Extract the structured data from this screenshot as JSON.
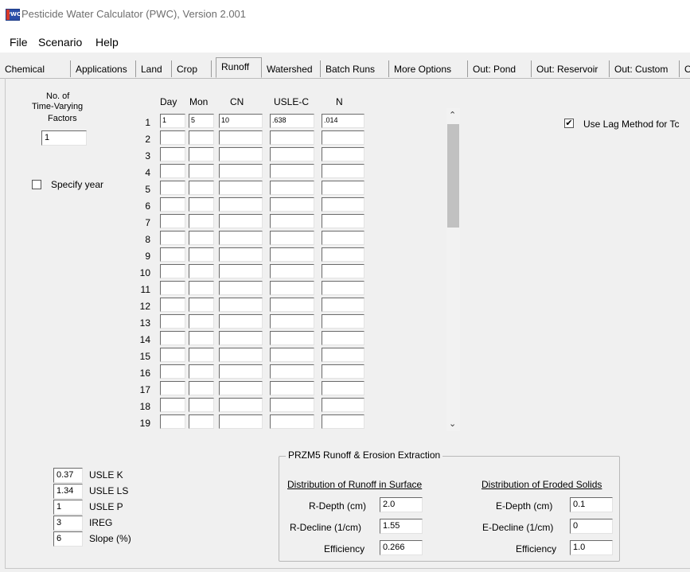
{
  "window": {
    "title": "Pesticide Water Calculator (PWC), Version 2.001",
    "icon_text": "PWC"
  },
  "menu": [
    {
      "label": "File"
    },
    {
      "label": "Scenario"
    },
    {
      "label": "Help"
    }
  ],
  "tabs": [
    {
      "label": "Chemical",
      "active": false
    },
    {
      "label": "Applications",
      "active": false
    },
    {
      "label": "Land",
      "active": false
    },
    {
      "label": "Crop",
      "active": false
    },
    {
      "label": "Runoff",
      "active": true
    },
    {
      "label": "Watershed",
      "active": false
    },
    {
      "label": "Batch Runs",
      "active": false
    },
    {
      "label": "More Options",
      "active": false
    },
    {
      "label": "Out: Pond",
      "active": false
    },
    {
      "label": "Out: Reservoir",
      "active": false
    },
    {
      "label": "Out: Custom",
      "active": false
    },
    {
      "label": "Ou",
      "active": false
    }
  ],
  "runoff": {
    "factors_label_1": "No. of",
    "factors_label_2": "Time-Varying",
    "factors_label_3": "Factors",
    "factors_value": "1",
    "specify_year_label": "Specify year",
    "specify_year_checked": false,
    "lag_method_label": "Use Lag Method for Tc",
    "lag_method_checked": true,
    "lag_method_mark": "✔",
    "columns": [
      "Day",
      "Mon",
      "CN",
      "USLE-C",
      "N"
    ],
    "rows": [
      {
        "num": "1",
        "day": "1",
        "mon": "5",
        "cn": "10",
        "uslec": ".638",
        "n": ".014"
      },
      {
        "num": "2",
        "day": "",
        "mon": "",
        "cn": "",
        "uslec": "",
        "n": ""
      },
      {
        "num": "3",
        "day": "",
        "mon": "",
        "cn": "",
        "uslec": "",
        "n": ""
      },
      {
        "num": "4",
        "day": "",
        "mon": "",
        "cn": "",
        "uslec": "",
        "n": ""
      },
      {
        "num": "5",
        "day": "",
        "mon": "",
        "cn": "",
        "uslec": "",
        "n": ""
      },
      {
        "num": "6",
        "day": "",
        "mon": "",
        "cn": "",
        "uslec": "",
        "n": ""
      },
      {
        "num": "7",
        "day": "",
        "mon": "",
        "cn": "",
        "uslec": "",
        "n": ""
      },
      {
        "num": "8",
        "day": "",
        "mon": "",
        "cn": "",
        "uslec": "",
        "n": ""
      },
      {
        "num": "9",
        "day": "",
        "mon": "",
        "cn": "",
        "uslec": "",
        "n": ""
      },
      {
        "num": "10",
        "day": "",
        "mon": "",
        "cn": "",
        "uslec": "",
        "n": ""
      },
      {
        "num": "11",
        "day": "",
        "mon": "",
        "cn": "",
        "uslec": "",
        "n": ""
      },
      {
        "num": "12",
        "day": "",
        "mon": "",
        "cn": "",
        "uslec": "",
        "n": ""
      },
      {
        "num": "13",
        "day": "",
        "mon": "",
        "cn": "",
        "uslec": "",
        "n": ""
      },
      {
        "num": "14",
        "day": "",
        "mon": "",
        "cn": "",
        "uslec": "",
        "n": ""
      },
      {
        "num": "15",
        "day": "",
        "mon": "",
        "cn": "",
        "uslec": "",
        "n": ""
      },
      {
        "num": "16",
        "day": "",
        "mon": "",
        "cn": "",
        "uslec": "",
        "n": ""
      },
      {
        "num": "17",
        "day": "",
        "mon": "",
        "cn": "",
        "uslec": "",
        "n": ""
      },
      {
        "num": "18",
        "day": "",
        "mon": "",
        "cn": "",
        "uslec": "",
        "n": ""
      },
      {
        "num": "19",
        "day": "",
        "mon": "",
        "cn": "",
        "uslec": "",
        "n": ""
      }
    ],
    "usle": [
      {
        "value": "0.37",
        "label": "USLE K"
      },
      {
        "value": "1.34",
        "label": "USLE LS"
      },
      {
        "value": "1",
        "label": "USLE P"
      },
      {
        "value": "3",
        "label": "IREG"
      },
      {
        "value": "6",
        "label": "Slope (%)"
      }
    ],
    "extraction": {
      "group_title": "PRZM5 Runoff & Erosion Extraction",
      "runoff_heading": "Distribution of Runoff in Surface",
      "solids_heading": "Distribution of Eroded Solids",
      "r_depth_label": "R-Depth (cm)",
      "r_depth_value": "2.0",
      "r_decline_label": "R-Decline (1/cm)",
      "r_decline_value": "1.55",
      "r_efficiency_label": "Efficiency",
      "r_efficiency_value": "0.266",
      "e_depth_label": "E-Depth (cm)",
      "e_depth_value": "0.1",
      "e_decline_label": "E-Decline (1/cm)",
      "e_decline_value": "0",
      "e_efficiency_label": "Efficiency",
      "e_efficiency_value": "1.0"
    }
  }
}
